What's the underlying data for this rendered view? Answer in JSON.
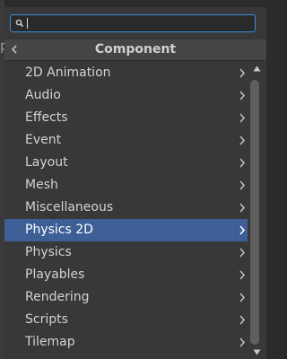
{
  "background": {
    "left_glyph": "p"
  },
  "search": {
    "value": "",
    "placeholder": ""
  },
  "header": {
    "title": "Component"
  },
  "items": [
    {
      "label": "2D Animation",
      "selected": false
    },
    {
      "label": "Audio",
      "selected": false
    },
    {
      "label": "Effects",
      "selected": false
    },
    {
      "label": "Event",
      "selected": false
    },
    {
      "label": "Layout",
      "selected": false
    },
    {
      "label": "Mesh",
      "selected": false
    },
    {
      "label": "Miscellaneous",
      "selected": false
    },
    {
      "label": "Physics 2D",
      "selected": true
    },
    {
      "label": "Physics",
      "selected": false
    },
    {
      "label": "Playables",
      "selected": false
    },
    {
      "label": "Rendering",
      "selected": false
    },
    {
      "label": "Scripts",
      "selected": false
    },
    {
      "label": "Tilemap",
      "selected": false
    }
  ],
  "colors": {
    "selection": "#3e5f96",
    "focus_border": "#3c8fd6",
    "popup_bg": "#383838"
  }
}
